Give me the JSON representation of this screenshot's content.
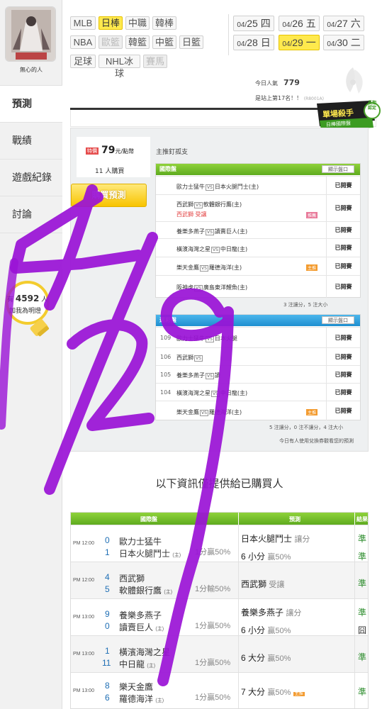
{
  "user": {
    "name": "無心的人"
  },
  "nav": {
    "items": [
      {
        "label": "預測",
        "active": true
      },
      {
        "label": "戰績"
      },
      {
        "label": "遊戲紀錄"
      },
      {
        "label": "討論"
      }
    ]
  },
  "bulb": {
    "prefix": "有",
    "count": "4592",
    "suffix": "人",
    "sub": "加我為明燈"
  },
  "sports": {
    "row1": [
      "MLB",
      "日棒",
      "中職",
      "韓棒"
    ],
    "row2": [
      "NBA",
      "歐籃",
      "韓籃",
      "中籃",
      "日籃"
    ],
    "row3": [
      "足球",
      "NHL冰球",
      "賽馬"
    ],
    "active": "日棒"
  },
  "dates": [
    {
      "md": "04/",
      "d": "25",
      "wd": "四"
    },
    {
      "md": "04/",
      "d": "26",
      "wd": "五"
    },
    {
      "md": "04/",
      "d": "27",
      "wd": "六"
    },
    {
      "md": "04/",
      "d": "28",
      "wd": "日"
    },
    {
      "md": "04/",
      "d": "29",
      "wd": "一",
      "active": true
    },
    {
      "md": "04/",
      "d": "30",
      "wd": "二"
    }
  ],
  "stats": {
    "popularity_label": "今日人氣",
    "popularity_value": "779",
    "rank_text": "是站上第17名！！",
    "rank_code": "(R8001A)"
  },
  "badge": {
    "title": "單場殺手",
    "sub": "日棒國際盤",
    "corner": "長期認定"
  },
  "panel": {
    "price_tag": "特價",
    "price": "79",
    "price_unit": "元/點幣",
    "buyers": "11 人購買",
    "buy_button": "購買預測",
    "headline": "主推釘孤支",
    "lines_button": "顯示盤口",
    "intl_header": "國際盤",
    "local_header": "運彩盤",
    "intl_rows": [
      {
        "away": "歐力士猛牛",
        "home": "日本火腿鬥士(主)",
        "status": "已開賽"
      },
      {
        "away": "西武獅",
        "home": "軟體銀行鷹(主)",
        "pick_team": "西武獅",
        "pick_type": "受讓",
        "tag": "推薦",
        "status": "已開賽"
      },
      {
        "away": "養樂多燕子",
        "home": "讀賣巨人(主)",
        "status": "已開賽"
      },
      {
        "away": "橫濱海灣之星",
        "home": "中日龍(主)",
        "status": "已開賽"
      },
      {
        "away": "樂天金鷹",
        "home": "羅德海洋(主)",
        "tag": "主推",
        "status": "已開賽"
      },
      {
        "away": "阪神虎",
        "home": "廣島東洋鯉魚(主)",
        "status": "已開賽"
      }
    ],
    "intl_tally": "3 注讓分，5 注大小",
    "local_rows": [
      {
        "num": "109",
        "away": "歐力士猛牛",
        "home": "日本火腿",
        "status": "已開賽"
      },
      {
        "num": "106",
        "away": "西武獅",
        "home": "",
        "status": "已開賽"
      },
      {
        "num": "105",
        "away": "養樂多燕子",
        "home": "讀",
        "status": "已開賽"
      },
      {
        "num": "104",
        "away": "橫濱海灣之星",
        "home": "中日龍(主)",
        "status": "已開賽"
      },
      {
        "num": "",
        "away": "樂天金鷹",
        "home": "羅德海洋(主)",
        "tag": "主推",
        "status": "已開賽"
      }
    ],
    "local_tally": "5 注讓分，0 注不讓分，4 注大小",
    "remark": "今日有人使用兌換券觀看您的預測"
  },
  "info_title": "以下資訊僅提供給已購買人",
  "results": {
    "headers": {
      "games": "國際盤",
      "prediction": "預測",
      "result": "結果"
    },
    "rows": [
      {
        "time": "PM 12:00",
        "s1": "0",
        "t1": "歐力士猛牛",
        "s2": "1",
        "t2": "日本火腿鬥士",
        "home": "(主)",
        "hcp": "1分贏50%",
        "p1": "日本火腿鬥士",
        "p1s": "讓分",
        "p2": "6 小分",
        "p2s": "贏50%",
        "r1": "準",
        "r2": "準"
      },
      {
        "time": "PM 12:00",
        "s1": "4",
        "t1": "西武獅",
        "s2": "5",
        "t2": "軟體銀行鷹",
        "home": "(主)",
        "hcp": "1分輸50%",
        "p1": "西武獅",
        "p1s": "受讓",
        "p2": "",
        "p2s": "",
        "r1": "準",
        "r2": ""
      },
      {
        "time": "PM 13:00",
        "s1": "9",
        "t1": "養樂多燕子",
        "s2": "0",
        "t2": "讀賣巨人",
        "home": "(主)",
        "hcp": "1分贏50%",
        "p1": "養樂多燕子",
        "p1s": "讓分",
        "p2": "6 小分",
        "p2s": "贏50%",
        "r1": "準",
        "r2": "囧"
      },
      {
        "time": "PM 13:00",
        "s1": "1",
        "t1": "橫濱海灣之星",
        "s2": "11",
        "t2": "中日龍",
        "home": "(主)",
        "hcp": "1分贏50%",
        "p1": "6 大分",
        "p1s": "贏50%",
        "p2": "",
        "p2s": "",
        "r1": "準",
        "r2": ""
      },
      {
        "time": "PM 13:00",
        "s1": "8",
        "t1": "樂天金鷹",
        "s2": "6",
        "t2": "羅德海洋",
        "home": "(主)",
        "hcp": "1分贏50%",
        "p1": "7 大分",
        "p1s": "贏50%",
        "p1tag": "主推",
        "p2": "",
        "p2s": "",
        "r1": "準",
        "r2": ""
      }
    ]
  },
  "colors": {
    "accent": "#ffe94d",
    "green": "#5eab1f",
    "blue": "#1f8fd0",
    "red": "#e34444",
    "annotation": "#9a12d6"
  },
  "annotation": {
    "text": "4/29"
  }
}
